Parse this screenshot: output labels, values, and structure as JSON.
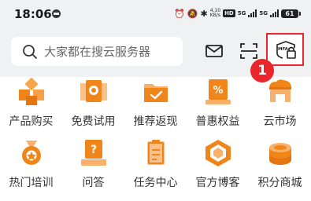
{
  "status_bar": {
    "time": "18:06",
    "net_speed_value": "4.10",
    "net_speed_unit": "KB/s",
    "hd_label": "HD",
    "net1": "5G",
    "net2": "5G",
    "battery": "61"
  },
  "header": {
    "search_placeholder": "大家都在搜云服务器",
    "mfa_label": "MFA",
    "callout_number": "1"
  },
  "grid": {
    "row1": [
      {
        "label": "产品购买",
        "icon": "boxes-icon"
      },
      {
        "label": "免费试用",
        "icon": "free-trial-icon"
      },
      {
        "label": "推荐返现",
        "icon": "folder-check-icon"
      },
      {
        "label": "普惠权益",
        "icon": "discount-bag-icon"
      },
      {
        "label": "云市场",
        "icon": "cloud-market-icon"
      }
    ],
    "row2": [
      {
        "label": "热门培训",
        "icon": "training-badge-icon"
      },
      {
        "label": "问答",
        "icon": "question-icon"
      },
      {
        "label": "任务中心",
        "icon": "task-clipboard-icon"
      },
      {
        "label": "官方博客",
        "icon": "blog-cube-icon"
      },
      {
        "label": "积分商城",
        "icon": "coin-stack-icon"
      }
    ]
  },
  "colors": {
    "accent_orange": "#f08519",
    "highlight_red": "#e8262b",
    "header_bg": "#f0f1f3"
  }
}
